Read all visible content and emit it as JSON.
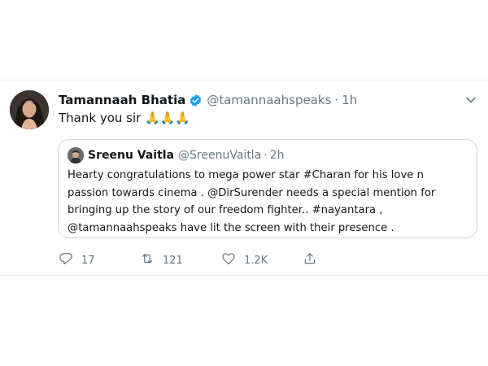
{
  "tweet": {
    "author_name": "Tamannaah Bhatia",
    "handle": "@tamannaahspeaks",
    "separator": "·",
    "time": "1h",
    "text": "Thank you sir 🙏🙏🙏"
  },
  "quoted_tweet": {
    "author_name": "Sreenu Vaitla",
    "handle": "@SreenuVaitla",
    "separator": "·",
    "time": "2h",
    "lines": [
      "Hearty congratulations to mega power star #Charan for his love n",
      "passion towards cinema . @DirSurender needs a special mention for",
      "bringing up the story of our freedom fighter.. #nayantara ,",
      "@tamannaahspeaks have lit the screen with their presence ."
    ]
  },
  "actions": {
    "reply": {
      "icon": "reply-icon",
      "count": "17"
    },
    "retweet": {
      "icon": "retweet-icon",
      "count": "121"
    },
    "like": {
      "icon": "heart-icon",
      "count": "1.2K"
    },
    "share": {
      "icon": "share-icon"
    }
  },
  "colors": {
    "text_primary": "#14171a",
    "text_secondary": "#657786",
    "border": "#ccd6dd",
    "verified_blue": "#1da1f2"
  }
}
